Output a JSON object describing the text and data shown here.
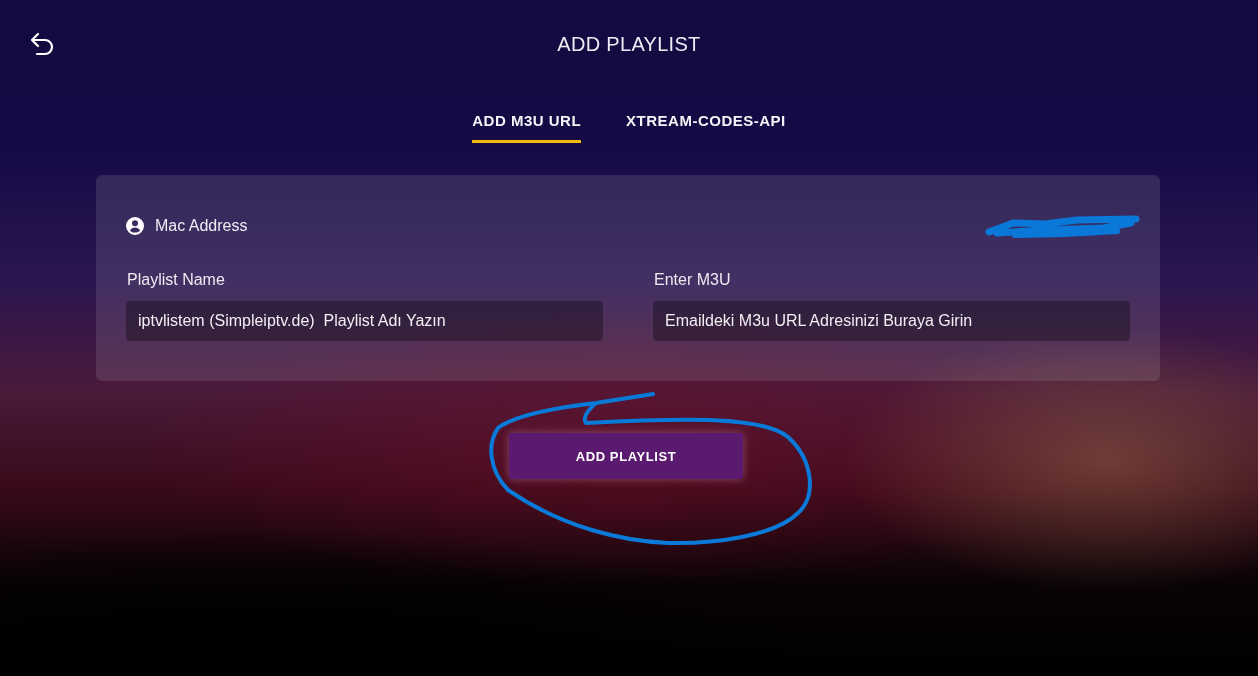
{
  "header": {
    "title": "ADD PLAYLIST"
  },
  "tabs": [
    {
      "label": "ADD M3U URL",
      "selected": true
    },
    {
      "label": "XTREAM-CODES-API",
      "selected": false
    }
  ],
  "form": {
    "mac_address": {
      "label": "Mac Address",
      "redacted": true
    },
    "fields": [
      {
        "label": "Playlist Name",
        "value": "iptvlistem (Simpleiptv.de)  Playlist Adı Yazın"
      },
      {
        "label": "Enter M3U",
        "value": "Emaildeki M3u URL Adresinizi Buraya Girin"
      }
    ]
  },
  "submit_button": {
    "label": "ADD PLAYLIST",
    "circled": true
  }
}
